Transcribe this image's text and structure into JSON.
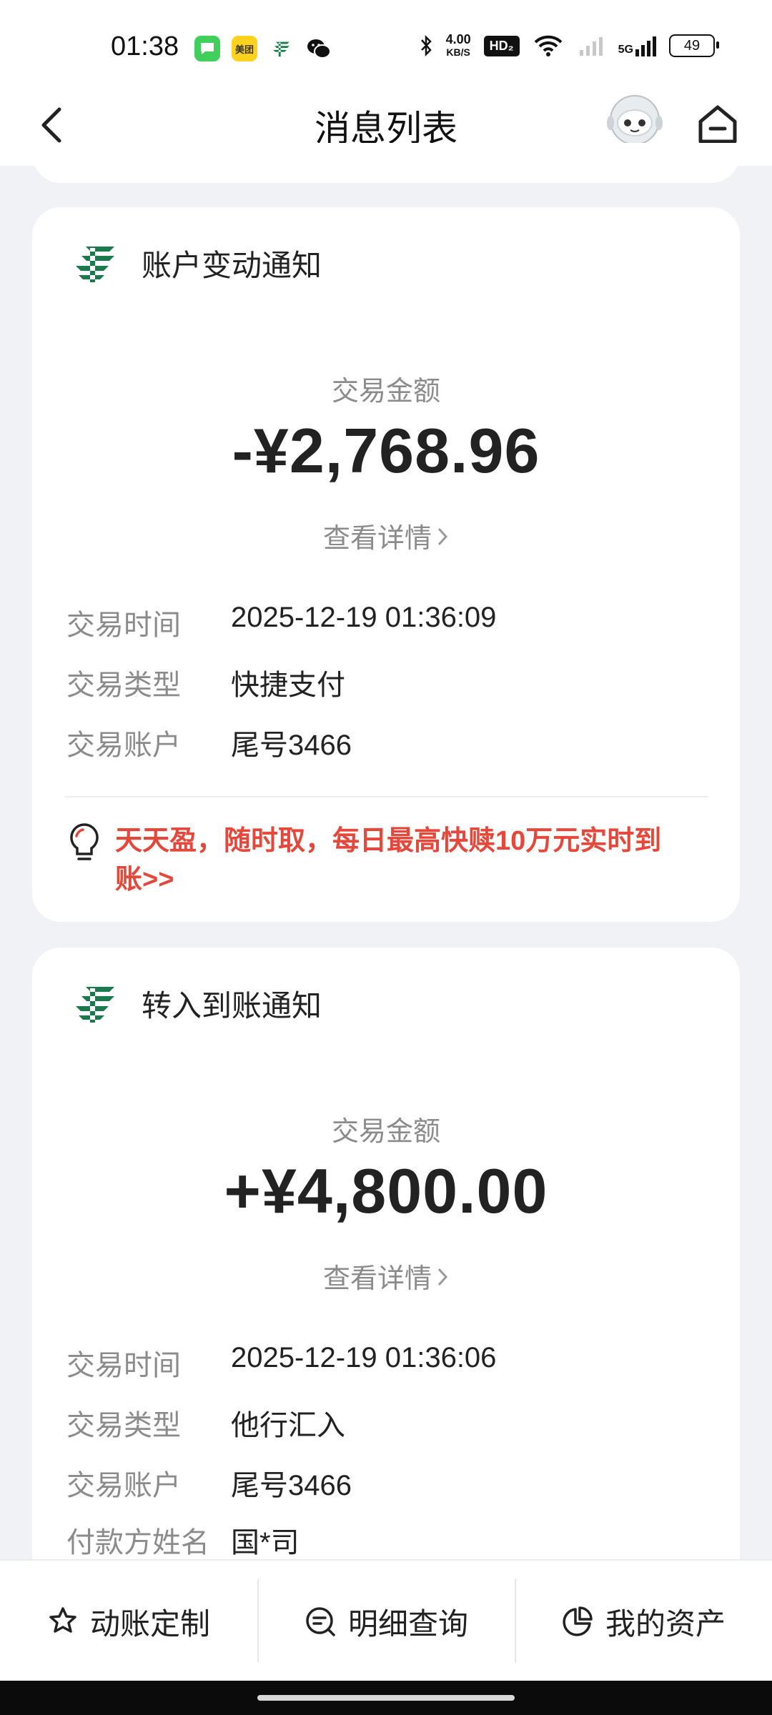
{
  "status_bar": {
    "time": "01:38",
    "app_icons": [
      "messages-icon",
      "meituan-icon",
      "postal-bank-icon",
      "wechat-icon"
    ],
    "meituan_label": "美团",
    "speed_value": "4.00",
    "speed_unit": "KB/S",
    "hd_badge": "HD₂",
    "signal_label": "5G",
    "battery": "49"
  },
  "nav": {
    "title": "消息列表"
  },
  "cards": [
    {
      "title": "账户变动通知",
      "amount_label": "交易金额",
      "amount": "-¥2,768.96",
      "detail_link": "查看详情",
      "rows": [
        {
          "label": "交易时间",
          "value": "2025-12-19 01:36:09"
        },
        {
          "label": "交易类型",
          "value": "快捷支付"
        },
        {
          "label": "交易账户",
          "value": "尾号3466"
        }
      ],
      "promo_line1": "天天盈，随时取，每日最高快赎10万元实时到",
      "promo_line2": "账>>"
    },
    {
      "title": "转入到账通知",
      "amount_label": "交易金额",
      "amount": "+¥4,800.00",
      "detail_link": "查看详情",
      "rows": [
        {
          "label": "交易时间",
          "value": "2025-12-19 01:36:06"
        },
        {
          "label": "交易类型",
          "value": "他行汇入"
        },
        {
          "label": "交易账户",
          "value": "尾号3466"
        },
        {
          "label": "付款方姓名",
          "value": "国*司"
        }
      ]
    }
  ],
  "tabbar": {
    "tabs": [
      {
        "label": "动账定制",
        "icon": "star-settings-icon"
      },
      {
        "label": "明细查询",
        "icon": "search-list-icon"
      },
      {
        "label": "我的资产",
        "icon": "pie-chart-icon"
      }
    ]
  },
  "colors": {
    "brand_green": "#1a7a4c",
    "promo_red": "#e5473a",
    "background": "#f1f2f6"
  }
}
